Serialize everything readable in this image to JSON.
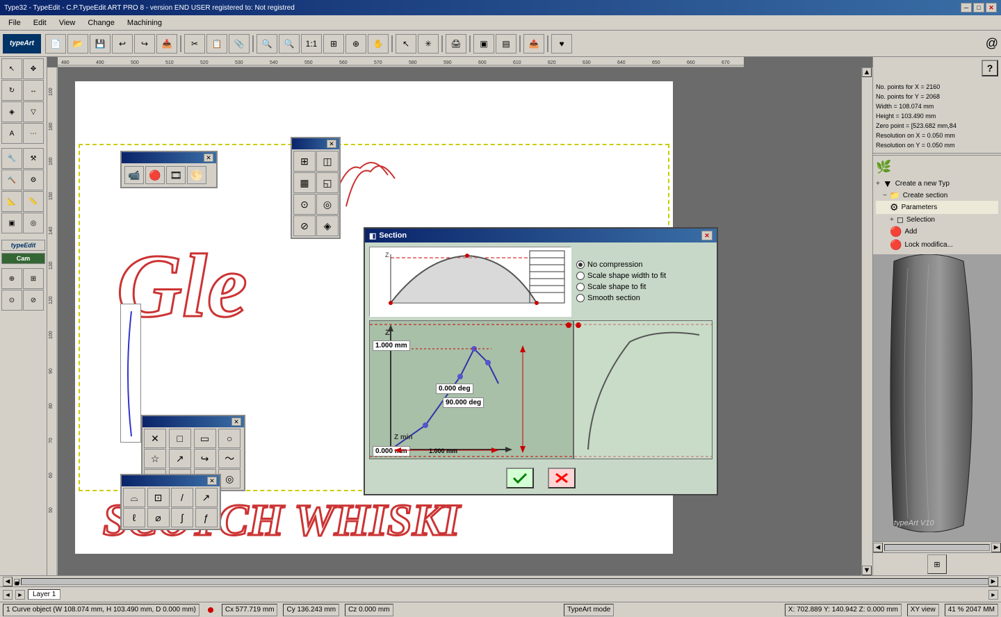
{
  "window": {
    "title": "Type32 - TypeEdit - C.P.TypeEdit  ART PRO 8 - version END USER registered to: Not registred"
  },
  "title_bar": {
    "title": "Type32 - TypeEdit - C.P.TypeEdit  ART PRO 8 - version END USER registered to: Not registred",
    "minimize": "─",
    "maximize": "□",
    "close": "✕"
  },
  "menu": {
    "items": [
      "File",
      "Edit",
      "View",
      "Change",
      "Machining"
    ]
  },
  "typeart_logo": "typeArt",
  "section_dialog": {
    "title": "Section",
    "close": "✕",
    "radio_options": [
      {
        "id": "no_compress",
        "label": "No compression",
        "selected": true
      },
      {
        "id": "scale_width",
        "label": "Scale shape width to fit",
        "selected": false
      },
      {
        "id": "scale_fit",
        "label": "Scale shape to fit",
        "selected": false
      },
      {
        "id": "smooth",
        "label": "Smooth section",
        "selected": false
      }
    ],
    "values": {
      "z_1000": "1.000 mm",
      "z_0": "0.000 mm",
      "z_min": "Z min",
      "z_label": "Z",
      "angle_0": "0.000 deg",
      "angle_90": "90.000 deg",
      "dim_1000": "1.000 mm"
    },
    "ok_btn": "✓",
    "cancel_btn": "✕"
  },
  "right_panel": {
    "help_text": "?",
    "info_lines": [
      "No. points for X = 2160",
      "No. points for Y = 2068",
      "Width = 108.074 mm",
      "Height = 103.490 mm",
      "Zero point = [523.682 mm,84",
      "Resolution on X = 0.050 mm",
      "Resolution on Y = 0.050 mm"
    ],
    "tree_items": [
      {
        "icon": "🌿",
        "label": "Create a new Typ",
        "indent": 0,
        "plus": "+"
      },
      {
        "icon": "📋",
        "label": "Create section",
        "indent": 1,
        "minus": "−"
      },
      {
        "icon": "⚙",
        "label": "Parameters",
        "indent": 2
      },
      {
        "icon": "◻",
        "label": "Selection",
        "indent": 2,
        "plus": "+"
      },
      {
        "icon": "🔴",
        "label": "Add",
        "indent": 2
      },
      {
        "icon": "🔴",
        "label": "Lock modifica...",
        "indent": 2
      }
    ]
  },
  "status_bar": {
    "curve_info": "1 Curve object (W 108.074 mm, H 103.490 mm, D 0.000 mm)",
    "cx": "Cx 577.719 mm",
    "cy": "Cy 136.243 mm",
    "cz": "Cz 0.000 mm",
    "mode": "TypeArt mode",
    "x": "X: 702.889",
    "y": "Y: 140.942",
    "z": "Z: 0.000 mm",
    "view": "XY view",
    "zoom": "41 % 2047 MM"
  },
  "layer_bar": {
    "layer": "Layer 1"
  },
  "canvas_text": {
    "scotch": "SCOTCH WHISKI",
    "glo": "Gle"
  },
  "floating_panel_2": {
    "title": ""
  },
  "floating_panel_3": {
    "title": ""
  },
  "typeArt_version": "typeArt  V10"
}
